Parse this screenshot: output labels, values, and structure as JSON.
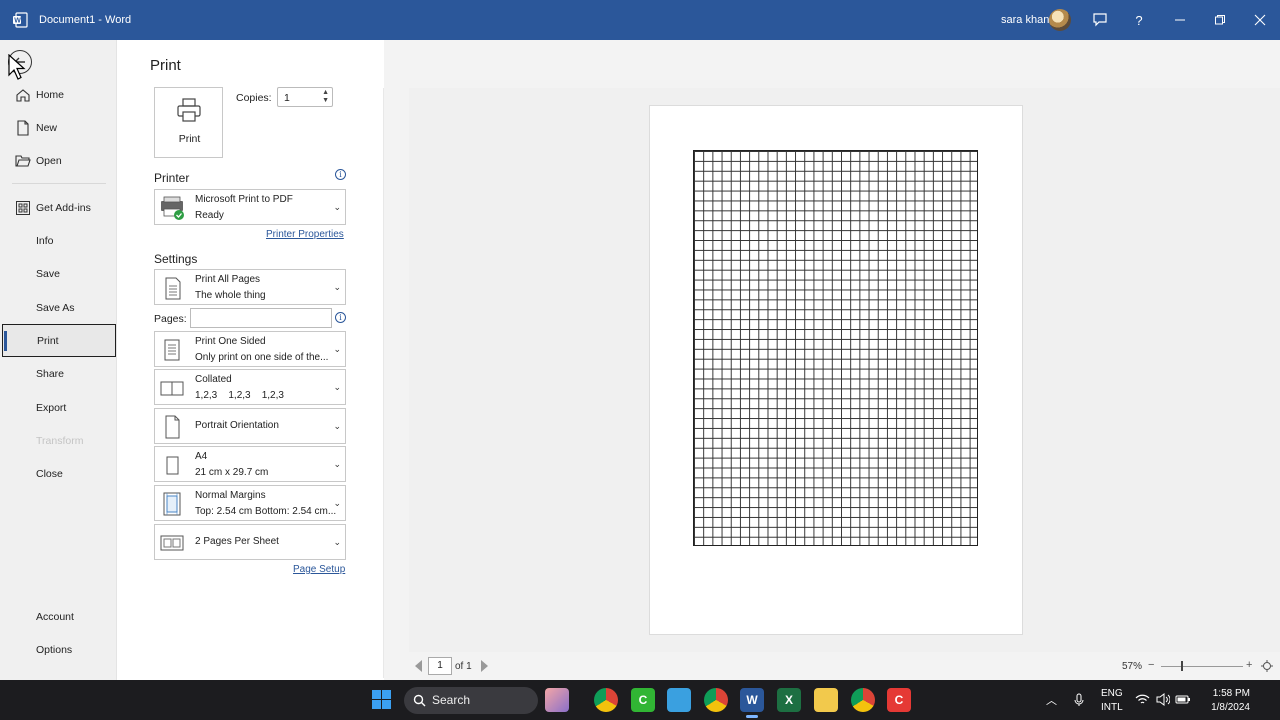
{
  "window": {
    "title": "Document1 - Word",
    "user_name": "sara khan"
  },
  "backstage": {
    "nav": {
      "home": "Home",
      "new": "New",
      "open": "Open",
      "get_addins": "Get Add-ins",
      "info": "Info",
      "save": "Save",
      "save_as": "Save As",
      "print": "Print",
      "share": "Share",
      "export": "Export",
      "transform": "Transform",
      "close": "Close",
      "account": "Account",
      "options": "Options"
    }
  },
  "print_panel": {
    "heading": "Print",
    "print_button_label": "Print",
    "copies_label": "Copies:",
    "copies_value": "1",
    "printer_section": "Printer",
    "printer_name": "Microsoft Print to PDF",
    "printer_status": "Ready",
    "printer_properties_link": "Printer Properties",
    "settings_section": "Settings",
    "pages_scope": {
      "title": "Print All Pages",
      "subtitle": "The whole thing"
    },
    "pages_label": "Pages:",
    "pages_value": "",
    "sides": {
      "title": "Print One Sided",
      "subtitle": "Only print on one side of the..."
    },
    "collation": {
      "title": "Collated",
      "subtitle": "1,2,3    1,2,3    1,2,3"
    },
    "orientation": {
      "title": "Portrait Orientation"
    },
    "paper_size": {
      "title": "A4",
      "subtitle": "21 cm x 29.7 cm"
    },
    "margins": {
      "title": "Normal Margins",
      "subtitle": "Top: 2.54 cm Bottom: 2.54 cm..."
    },
    "per_sheet": {
      "title": "2 Pages Per Sheet"
    },
    "page_setup_link": "Page Setup"
  },
  "preview": {
    "current_page": "1",
    "of_pages": "of 1",
    "zoom": "57%"
  },
  "taskbar": {
    "search_placeholder": "Search",
    "language_line1": "ENG",
    "language_line2": "INTL",
    "time": "1:58 PM",
    "date": "1/8/2024"
  },
  "colors": {
    "word_blue": "#2b579a",
    "taskbar": "#1c1c1f",
    "excel_green": "#1d6f42"
  }
}
